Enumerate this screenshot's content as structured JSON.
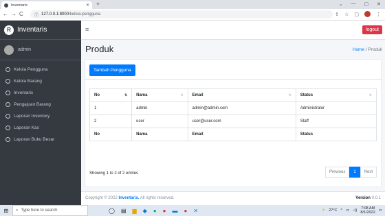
{
  "browser": {
    "tab_title": "Inventaris",
    "url_host": "127.0.0.1:8000",
    "url_path": "/kelola-pengguna"
  },
  "brand": {
    "name": "Inventaris",
    "logo_letter": "R"
  },
  "user": {
    "name": "admin"
  },
  "sidebar": {
    "items": [
      {
        "label": "Kelola Pengguna"
      },
      {
        "label": "Kelola Barang"
      },
      {
        "label": "Inventaris"
      },
      {
        "label": "Pengajuan Barang"
      },
      {
        "label": "Laporan Inventory"
      },
      {
        "label": "Laporan Kas"
      },
      {
        "label": "Laporan Buku Besar"
      }
    ]
  },
  "topnav": {
    "logout_label": "logout"
  },
  "header": {
    "title": "Produk",
    "breadcrumb_home": "Home",
    "breadcrumb_sep": " / ",
    "breadcrumb_current": "Produk"
  },
  "toolbar": {
    "add_label": "Tambah Pengguna"
  },
  "table": {
    "headers": [
      "No",
      "Nama",
      "Email",
      "Status"
    ],
    "rows": [
      [
        "1",
        "admin",
        "admin@admin.com",
        "Administrator"
      ],
      [
        "2",
        "user",
        "user@user.com",
        "Staff"
      ]
    ]
  },
  "pagination": {
    "info": "Showing 1 to 2 of 2 entries",
    "previous": "Previous",
    "current": "1",
    "next": "Next"
  },
  "footer": {
    "copyright": "Copyright © 2022 ",
    "brand": "Inventaris.",
    "rights": " All rights reserved.",
    "version_label": "Version",
    "version": "0.0.1"
  },
  "taskbar": {
    "search_placeholder": "Type here to search",
    "weather": "27°C",
    "time": "7:08 AM",
    "date": "8/1/2022"
  }
}
